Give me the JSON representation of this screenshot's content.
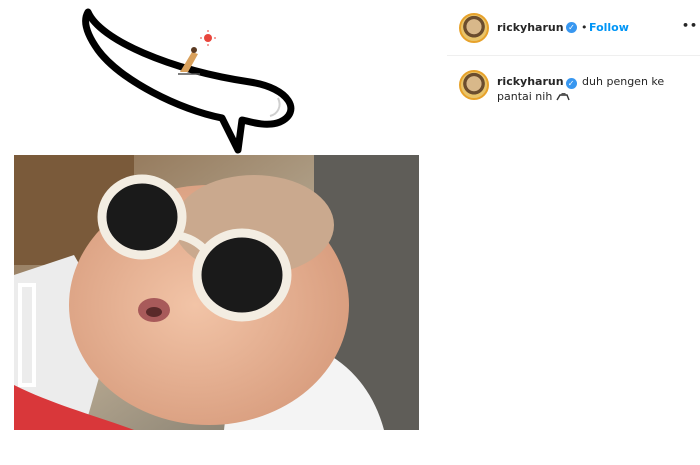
{
  "post": {
    "username": "rickyharun",
    "follow_label": "Follow",
    "separator": "•",
    "more_label": "••",
    "verified_glyph": "✓"
  },
  "caption": {
    "username": "rickyharun",
    "text": "duh pengen ke pantai nih",
    "emoji_name": "beach-lounger-icon"
  },
  "colors": {
    "follow_blue": "#0095f6",
    "verified_blue": "#3897f0",
    "avatar_ring": "#e7a22b"
  }
}
